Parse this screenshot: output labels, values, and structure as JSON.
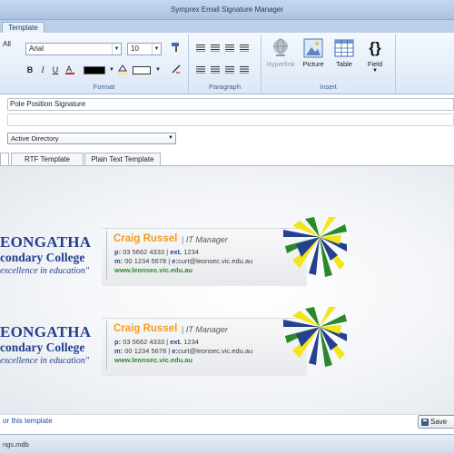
{
  "window": {
    "title": "Symprex Email Signature Manager"
  },
  "ribbon": {
    "tab_template": "Template",
    "all_label": "All",
    "format": {
      "group_label": "Format",
      "font_name": "Arial",
      "font_size": "10",
      "bold": "B",
      "italic": "I",
      "underline": "U",
      "font_color_hex": "#000000"
    },
    "paragraph": {
      "group_label": "Paragraph"
    },
    "insert": {
      "group_label": "Insert",
      "hyperlink": "Hyperlink",
      "picture": "Picture",
      "table": "Table",
      "field": "Field",
      "field_glyph": "{}"
    }
  },
  "form": {
    "template_name": "Pole Position Signature",
    "source": "Active Directory"
  },
  "subtabs": {
    "rtf": "RTF Template",
    "plain": "Plain Text Template"
  },
  "signature": {
    "school_line1": "EONGATHA",
    "school_line2": "condary College",
    "motto": "excellence in education\"",
    "name": "Craig Russel",
    "divider": "|",
    "title": "IT Manager",
    "p_key": "p:",
    "p_val": "03 5662 4333",
    "ext_key": "ext.",
    "ext_val": "1234",
    "m_key": "m:",
    "m_val": "00 1234 5678",
    "e_key": "e:",
    "e_val": "curt@leonsec.vic.edu.au",
    "web": "www.leonsec.vic.edu.au",
    "colors": {
      "blue": "#24408e",
      "orange": "#f39c1e",
      "green": "#2a8a2a",
      "yellow": "#f3e51a"
    }
  },
  "bottom": {
    "link": "or this template",
    "save": "Save"
  },
  "status": {
    "file": "ngs.mdb"
  }
}
